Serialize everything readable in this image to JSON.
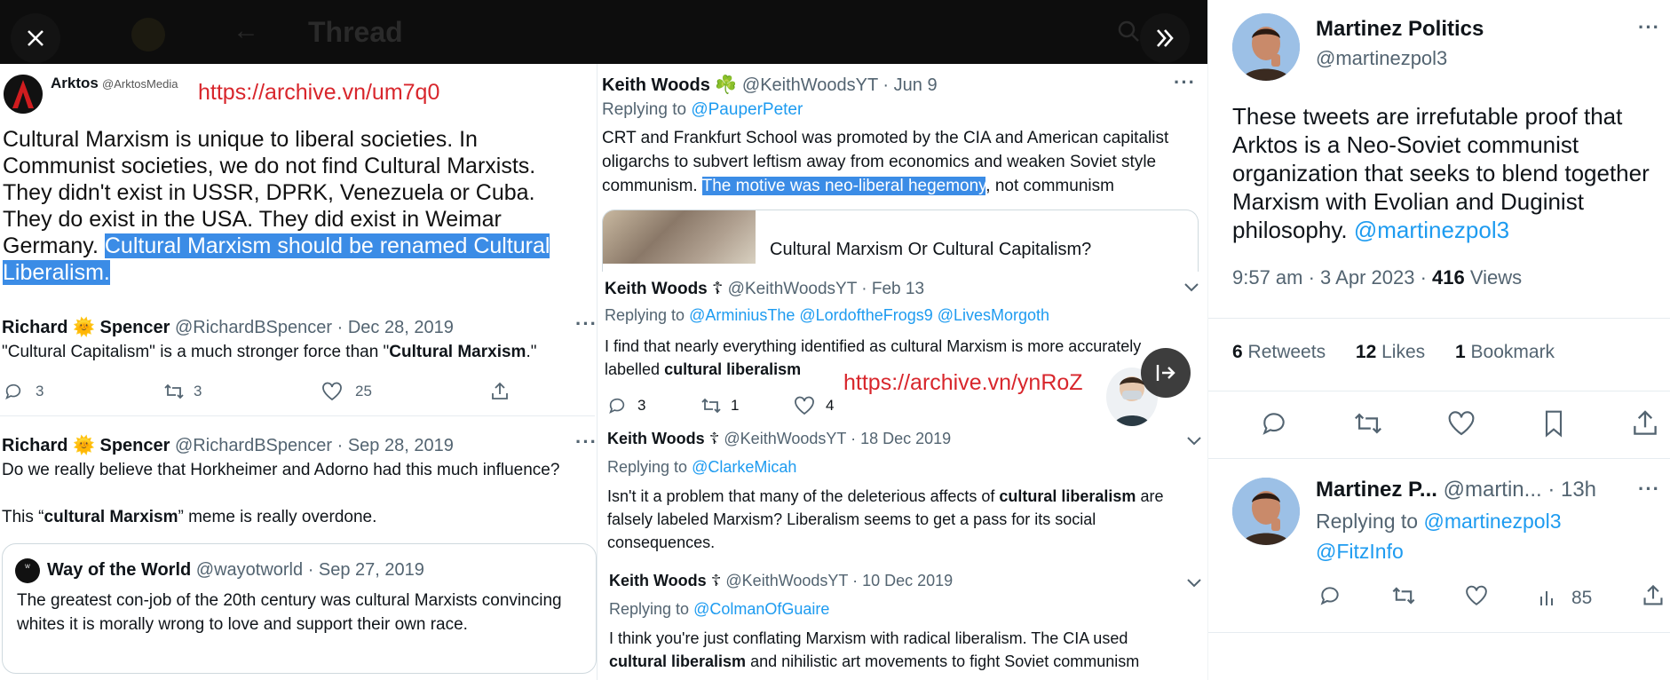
{
  "viewer": {
    "header_title": "Thread",
    "close_label": "Close",
    "next_label": "Next"
  },
  "arktos": {
    "name": "Arktos",
    "handle": "@ArktosMedia",
    "archive_link": "https://archive.vn/um7q0",
    "text_plain": "Cultural Marxism is unique to liberal societies. In Communist societies, we do not find Cultural Marxists. They didn't exist in USSR, DPRK, Venezuela or Cuba. They do exist in the USA. They did exist in Weimar Germany.",
    "text_highlight": "Cultural Marxism should be renamed Cultural Liberalism."
  },
  "spencer1": {
    "name_a": "Richard",
    "emoji": "🌞",
    "name_b": "Spencer",
    "handle": "@RichardBSpencer",
    "date": "· Dec 28, 2019",
    "text_a": "\"Cultural Capitalism\" is a much stronger force than \"",
    "text_bold": "Cultural Marxism",
    "text_b": ".\"",
    "replies": "3",
    "retweets": "3",
    "likes": "25"
  },
  "spencer2": {
    "name_a": "Richard",
    "emoji": "🌞",
    "name_b": "Spencer",
    "handle": "@RichardBSpencer",
    "date": "· Sep 28, 2019",
    "line1": "Do we really believe that Horkheimer and Adorno had this much influence?",
    "line2_a": "This “",
    "line2_bold": "cultural Marxism",
    "line2_b": "” meme  is really overdone.",
    "quote": {
      "name": "Way of the World",
      "handle": "@wayotworld",
      "date": "· Sep 27, 2019",
      "text": "The greatest con-job of the 20th century was cultural Marxists convincing whites it is morally wrong to love and support their own race."
    }
  },
  "woods1": {
    "name": "Keith Woods",
    "emoji": "☘️",
    "handle": "@KeithWoodsYT",
    "date": "· Jun 9",
    "replying_label": "Replying to",
    "replying_to": "@PauperPeter",
    "text_a": "CRT and Frankfurt School was promoted by the CIA and American capitalist oligarchs to subvert leftism away from economics and weaken Soviet style communism.",
    "text_highlight": "The motive was neo-liberal hegemony",
    "text_b": ", not communism",
    "card_title": "Cultural Marxism Or Cultural Capitalism?"
  },
  "woods2": {
    "name": "Keith Woods",
    "emoji": "☦",
    "handle": "@KeithWoodsYT",
    "date": "· Feb 13",
    "replying_label": "Replying to",
    "replying_to": "@ArminiusThe @LordoftheFrogs9 @LivesMorgoth",
    "text_a": "I find that nearly everything identified as cultural Marxism is more accurately labelled",
    "text_bold": "cultural liberalism",
    "archive_link": "https://archive.vn/ynRoZ",
    "replies": "3",
    "retweets": "1",
    "likes": "4"
  },
  "woods3": {
    "name": "Keith Woods",
    "emoji": "☦",
    "handle": "@KeithWoodsYT",
    "date": "· 18 Dec 2019",
    "replying_label": "Replying to",
    "replying_to": "@ClarkeMicah",
    "text_a": "Isn't it a problem that many of the deleterious affects of",
    "text_bold": "cultural liberalism",
    "text_b": "are falsely labeled Marxism? Liberalism seems to get a pass for its social consequences."
  },
  "woods4": {
    "name": "Keith Woods",
    "emoji": "☦",
    "handle": "@KeithWoodsYT",
    "date": "· 10 Dec 2019",
    "replying_label": "Replying to",
    "replying_to": "@ColmanOfGuaire",
    "text_a": "I think you're just conflating Marxism with radical liberalism. The CIA used",
    "text_bold": "cultural liberalism",
    "text_b": "and nihilistic art movements to fight Soviet communism"
  },
  "right": {
    "name": "Martinez Politics",
    "handle": "@martinezpol3",
    "text": "These tweets are irrefutable proof that Arktos is a Neo-Soviet communist organization that seeks to blend together Marxism with Evolian and Duginist philosophy.",
    "mention": "@martinezpol3",
    "time": "9:57 am · 3 Apr 2023 ·",
    "views_count": "416",
    "views_label": "Views",
    "retweets_count": "6",
    "retweets_label": "Retweets",
    "likes_count": "12",
    "likes_label": "Likes",
    "bookmarks_count": "1",
    "bookmarks_label": "Bookmark",
    "reply": {
      "name": "Martinez P...",
      "handle": "@martin...",
      "time": "· 13h",
      "replying_label": "Replying to",
      "mention1": "@martinezpol3",
      "mention2": "@FitzInfo",
      "views": "85"
    }
  },
  "colors": {
    "highlight": "#3b8ce6",
    "link_blue": "#1d9bf0",
    "archive_red": "#d8262c"
  }
}
